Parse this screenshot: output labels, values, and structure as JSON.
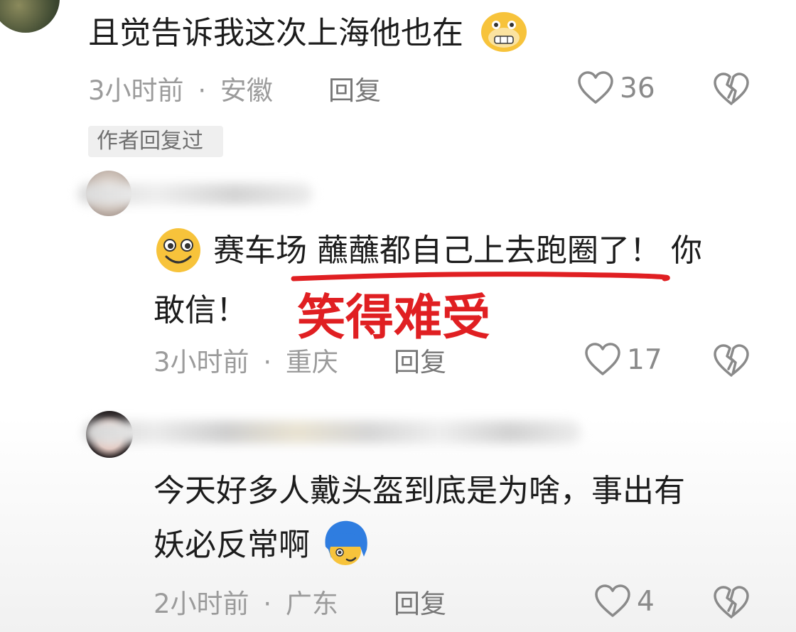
{
  "comments": [
    {
      "text": "且觉告诉我这次上海他也在",
      "time": "3小时前",
      "location": "安徽",
      "reply_label": "回复",
      "likes": "36",
      "badge": "作者回复过"
    },
    {
      "text_line1": "赛车场 蘸蘸都自己上去跑圈了！ 你",
      "text_line2": "敢信！",
      "time": "3小时前",
      "location": "重庆",
      "reply_label": "回复",
      "likes": "17",
      "annotation": "笑得难受"
    },
    {
      "text_line1": "今天好多人戴头盔到底是为啥，事出有",
      "text_line2": "妖必反常啊",
      "time": "2小时前",
      "location": "广东",
      "reply_label": "回复",
      "likes": "4"
    }
  ],
  "separator": "·",
  "colors": {
    "annotation_red": "#e01f22",
    "meta_gray": "#9b9b9b",
    "badge_bg": "#efefef"
  }
}
